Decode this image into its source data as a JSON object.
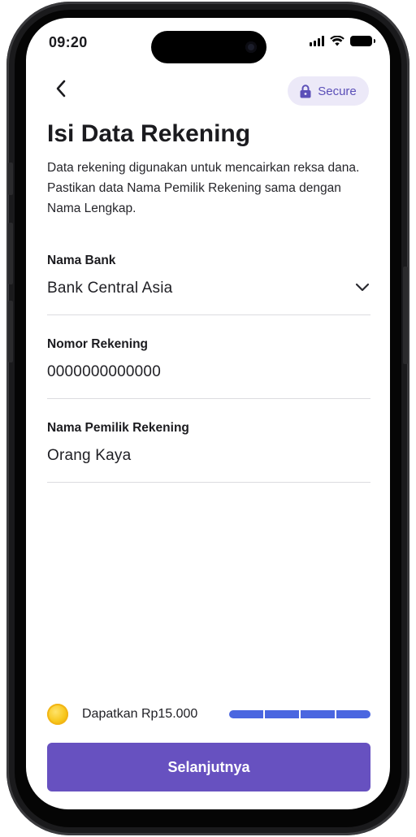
{
  "status_bar": {
    "time": "09:20"
  },
  "header": {
    "back_icon": "chevron-left-icon",
    "secure_label": "Secure",
    "secure_icon": "lock-icon"
  },
  "page": {
    "title": "Isi Data Rekening",
    "description": "Data rekening digunakan untuk mencairkan reksa dana. Pastikan data Nama Pemilik Rekening sama dengan Nama Lengkap."
  },
  "form": {
    "bank": {
      "label": "Nama Bank",
      "value": "Bank Central Asia"
    },
    "account_number": {
      "label": "Nomor Rekening",
      "value": "0000000000000"
    },
    "account_owner": {
      "label": "Nama Pemilik Rekening",
      "value": "Orang Kaya"
    }
  },
  "reward": {
    "text": "Dapatkan Rp15.000",
    "progress_segments_filled": 4,
    "progress_segments_total": 4
  },
  "footer": {
    "next_label": "Selanjutnya"
  },
  "colors": {
    "primary": "#6751c0",
    "progress": "#4a66e0",
    "secure_bg": "#ece9f8",
    "secure_text": "#5b4fb8",
    "coin": "#f7c61a"
  }
}
